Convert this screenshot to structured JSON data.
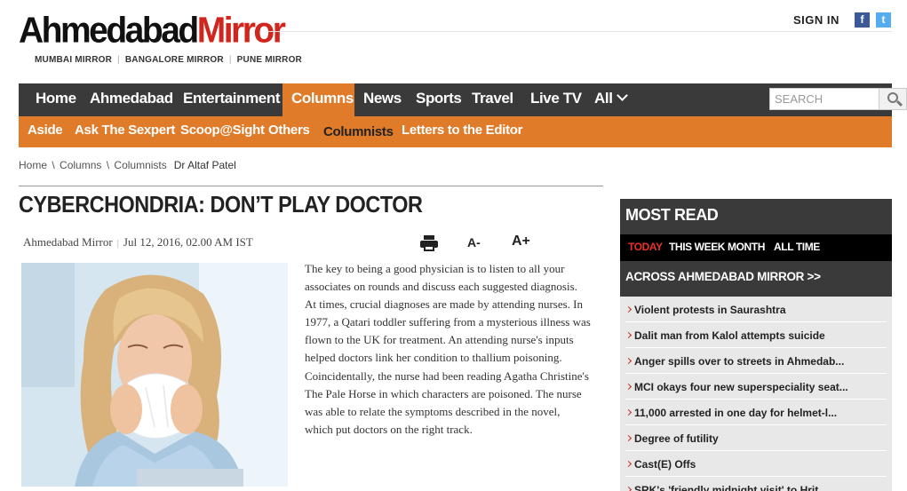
{
  "header": {
    "logo_part1": "Ahmedabad",
    "logo_part2": "Mirror",
    "sister_sites": [
      "MUMBAI MIRROR",
      "BANGALORE MIRROR",
      "PUNE MIRROR"
    ],
    "signin": "SIGN IN",
    "facebook_glyph": "f",
    "twitter_glyph": "t"
  },
  "nav": {
    "items": [
      "Home",
      "Ahmedabad",
      "Entertainment",
      "Columns",
      "News",
      "Sports",
      "Travel",
      "Live TV",
      "All"
    ],
    "active": "Columns",
    "search_placeholder": "SEARCH"
  },
  "subnav": {
    "items": [
      "Aside",
      "Ask The Sexpert",
      "Scoop@Sight",
      "Others",
      "Columnists",
      "Letters to the Editor"
    ],
    "active": "Columnists"
  },
  "breadcrumb": {
    "items": [
      "Home",
      "Columns",
      "Columnists"
    ],
    "current": "Dr Altaf Patel"
  },
  "article": {
    "title": "CYBERCHONDRIA: DON’T PLAY DOCTOR",
    "source": "Ahmedabad Mirror",
    "date": "Jul 12, 2016, 02.00 AM IST",
    "font_decrease": "A-",
    "font_increase": "A+",
    "body": "The key to being a good physician is to listen to all your associates on rounds and discuss each suggested diagnosis. At times, crucial diagnoses are made by attending nurses. In 1977, a Qatari toddler suffering from a mysterious illness was flown to the UK for treatment. An attending nurse's inputs helped doctors link her condition to thallium poisoning. Coincidentally, the nurse had been reading Agatha Christine's The Pale Horse in which characters are poisoned. The nurse was able to relate the symptoms described in the novel, which put doctors on the right track."
  },
  "most_read": {
    "heading": "MOST READ",
    "tabs": [
      "TODAY",
      "THIS WEEK",
      "MONTH",
      "ALL TIME"
    ],
    "active_tab": "TODAY",
    "subheading": "ACROSS AHMEDABAD MIRROR >>",
    "items": [
      "Violent protests in Saurashtra",
      "Dalit man from Kalol attempts suicide",
      "Anger spills over to streets in Ahmedab...",
      "MCI okays four new superspeciality seat...",
      "11,000 arrested in one day for helmet-l...",
      "Degree of futility",
      "Cast(E) Offs",
      "SRK's 'friendly midnight visit' to Hrit..."
    ]
  },
  "colors": {
    "brand_red": "#d0261d",
    "nav_dark": "#3a3a3a",
    "accent_orange": "#e07b2a"
  }
}
